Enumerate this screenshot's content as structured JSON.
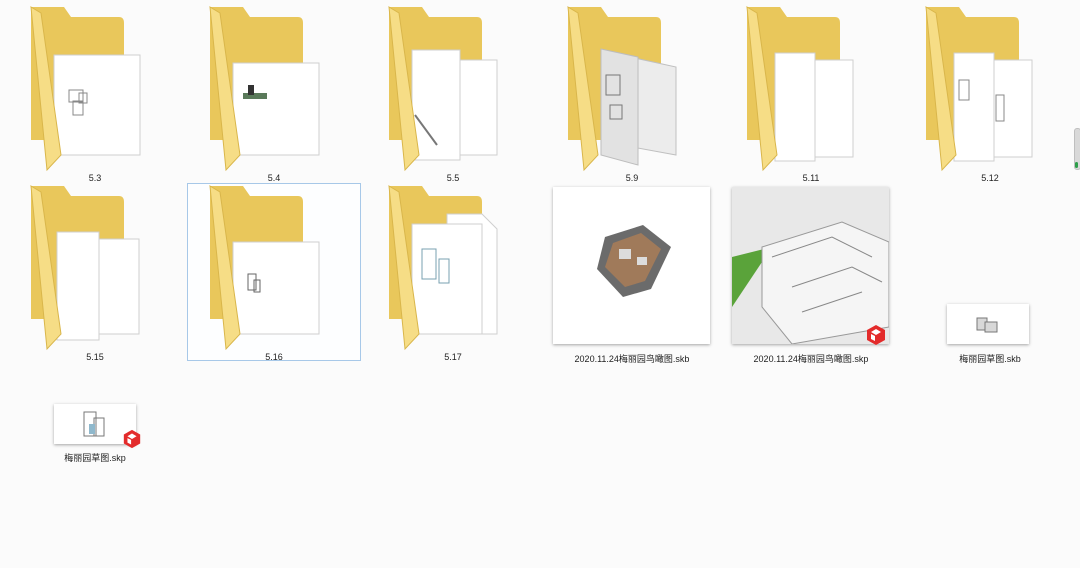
{
  "items": [
    {
      "label": "5.3"
    },
    {
      "label": "5.4"
    },
    {
      "label": "5.5"
    },
    {
      "label": "5.9"
    },
    {
      "label": "5.11"
    },
    {
      "label": "5.12"
    },
    {
      "label": "5.15"
    },
    {
      "label": "5.16"
    },
    {
      "label": "5.17"
    },
    {
      "label": "2020.11.24梅丽园鸟瞰图.skb"
    },
    {
      "label": "2020.11.24梅丽园鸟瞰图.skp"
    },
    {
      "label": "梅丽园草图.skb"
    },
    {
      "label": "梅丽园草图.skp"
    }
  ],
  "colors": {
    "folder_back": "#e9c75b",
    "folder_front": "#f6dd86",
    "selection_border": "#a7c8e8",
    "sketchup_badge": "#e32b2b",
    "grass": "#5aa33a"
  },
  "icons": [
    "folder-icon",
    "skb-file-icon",
    "skp-file-icon",
    "sketchup-badge-icon"
  ]
}
